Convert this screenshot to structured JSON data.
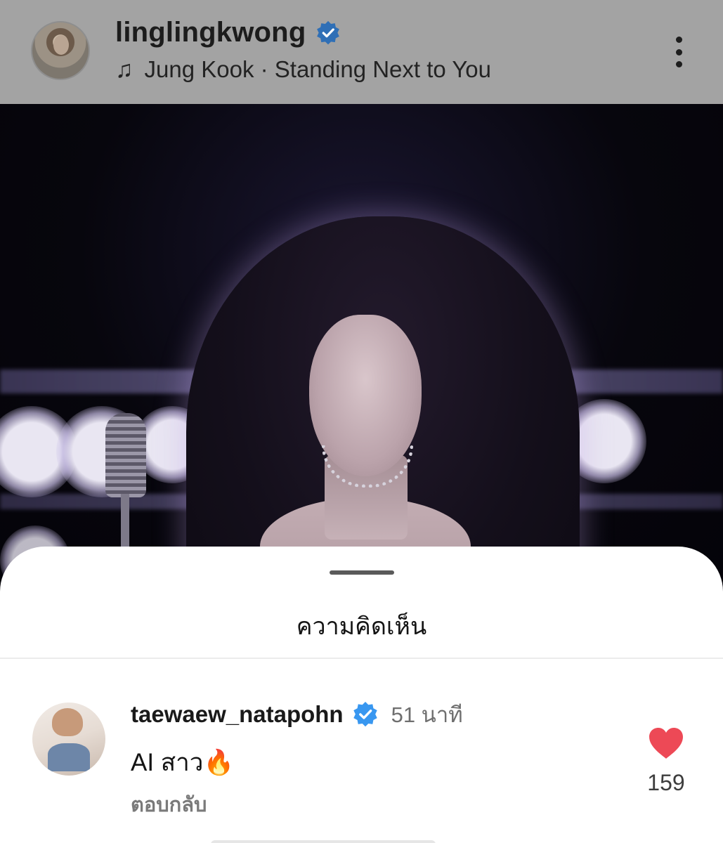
{
  "post": {
    "username": "linglingkwong",
    "music": {
      "icon": "music-note-icon",
      "text": "Jung Kook · Standing Next to You"
    }
  },
  "comments_sheet": {
    "title": "ความคิดเห็น",
    "comments": [
      {
        "username": "taewaew_natapohn",
        "verified": true,
        "time": "51 นาที",
        "text": "AI สาว🔥",
        "reply_label": "ตอบกลับ",
        "like_count": "159"
      }
    ]
  },
  "colors": {
    "verified_blue": "#3897f0",
    "like_red": "#ed4956"
  }
}
